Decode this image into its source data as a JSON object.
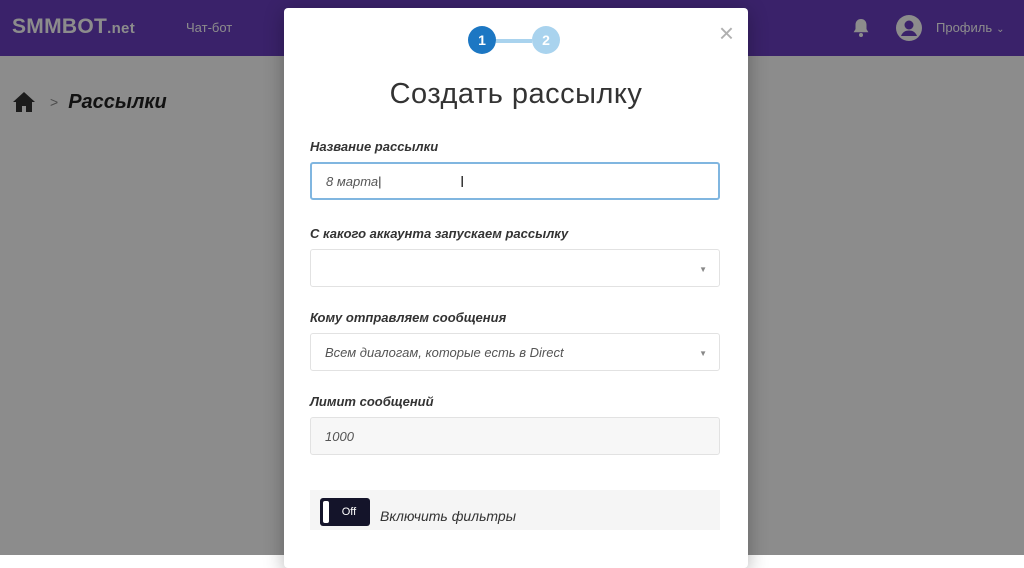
{
  "topbar": {
    "logo_main": "SMMBOT",
    "logo_suffix": ".net",
    "nav_chatbot": "Чат-бот",
    "profile_label": "Профиль",
    "bell_icon": "bell-icon",
    "avatar_icon": "user-avatar-icon"
  },
  "breadcrumb": {
    "home_icon": "home-icon",
    "title": "Рассылки"
  },
  "modal": {
    "steps": [
      "1",
      "2"
    ],
    "active_step": 1,
    "title": "Создать рассылку",
    "name_label": "Название рассылки",
    "name_value": "8 марта",
    "account_label": "С какого аккаунта запускаем рассылку",
    "account_value": "",
    "recipients_label": "Кому отправляем сообщения",
    "recipients_value": "Всем диалогам, которые есть в Direct",
    "limit_label": "Лимит сообщений",
    "limit_value": "1000",
    "filter_toggle_label": "Off",
    "filter_label": "Включить фильтры",
    "close_icon": "close-icon"
  },
  "colors": {
    "brand": "#6a3ec2",
    "step_active": "#1c77c3",
    "step_inactive": "#a9d3ee",
    "toggle_off": "#14142a"
  }
}
